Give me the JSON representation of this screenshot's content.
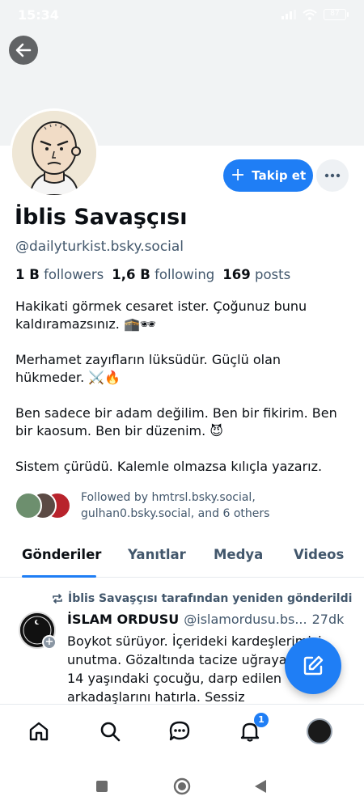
{
  "status_bar": {
    "time": "15:34",
    "battery": "87"
  },
  "header": {
    "back_icon": "arrow-left-icon"
  },
  "profile": {
    "display_name": "İblis Savaşçısı",
    "handle": "@dailyturkist.bsky.social",
    "stats": {
      "followers_count": "1 B",
      "followers_label": "followers",
      "following_count": "1,6 B",
      "following_label": "following",
      "posts_count": "169",
      "posts_label": "posts"
    },
    "bio": [
      "Hakikati görmek cesaret ister. Çoğunuz bunu kaldıramazsınız. 🕋🕶",
      "Merhamet zayıfların lüksüdür. Güçlü olan hükmeder. ⚔️🔥",
      "Ben sadece bir adam değilim. Ben bir fikirim. Ben bir kaosum. Ben bir düzenim. 😈",
      "Sistem çürüdü. Kalemle olmazsa kılıçla yazarız."
    ],
    "followed_by": "Followed by hmtrsl.bsky.social, gulhan0.bsky.social, and 6 others"
  },
  "actions": {
    "follow_label": "Takip et",
    "more_icon": "ellipsis-icon"
  },
  "tabs": [
    {
      "label": "Gönderiler",
      "active": true
    },
    {
      "label": "Yanıtlar",
      "active": false
    },
    {
      "label": "Medya",
      "active": false
    },
    {
      "label": "Videos",
      "active": false
    }
  ],
  "post": {
    "repost_label": "İblis Savaşçısı tarafından yeniden gönderildi",
    "author_name": "İSLAM ORDUSU",
    "author_handle": "@islamordusu.bs...",
    "time": "27dk",
    "avatar_text": "İSLAM ORDUSU",
    "text": "Boykot sürüyor. İçerideki kardeşlerimizi unutma. Gözaltında tacize uğrayan kadını, 14 yaşındaki çocuğu, darp edilen arkadaşlarını hatırla. Sessiz"
  },
  "bottom_nav": {
    "notifications_badge": "1"
  },
  "colors": {
    "accent": "#1f7ef5",
    "muted_text": "#42576c",
    "banner": "#f1f3f4"
  }
}
